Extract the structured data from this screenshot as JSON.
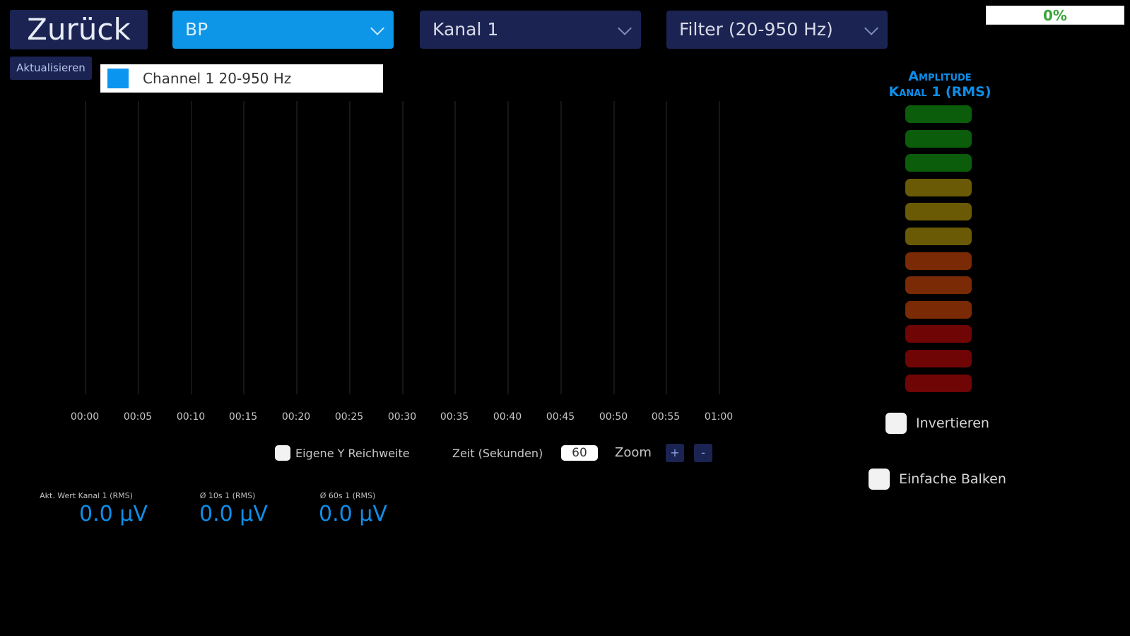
{
  "header": {
    "back_label": "Zurück",
    "refresh_label": "Aktualisieren",
    "mode_select": "BP",
    "channel_select": "Kanal 1",
    "filter_select": "Filter (20-950 Hz)",
    "progress": {
      "value": 0,
      "label": "0%"
    }
  },
  "chart_data": {
    "type": "line",
    "legend": [
      "Channel 1 20-950 Hz"
    ],
    "x_ticks": [
      "00:00",
      "00:05",
      "00:10",
      "00:15",
      "00:20",
      "00:25",
      "00:30",
      "00:35",
      "00:40",
      "00:45",
      "00:50",
      "00:55",
      "01:00"
    ],
    "series": [
      {
        "name": "Channel 1 20-950 Hz",
        "color": "#0a96f0",
        "values": []
      }
    ],
    "grid": "vertical"
  },
  "amplitude": {
    "title_line1": "Amplitude",
    "title_line2": "Kanal 1 (RMS)",
    "bar_colors": [
      "#0b5c0b",
      "#0b5c0b",
      "#0b5c0b",
      "#6b5a05",
      "#6b5a05",
      "#6b5a05",
      "#7a2a05",
      "#7a2a05",
      "#7a2a05",
      "#700505",
      "#700505",
      "#700505"
    ],
    "lit_bars": 0
  },
  "controls": {
    "own_y_range_label": "Eigene Y Reichweite",
    "own_y_range_checked": false,
    "time_label": "Zeit (Sekunden)",
    "time_value": "60",
    "zoom_label": "Zoom",
    "zoom_in": "+",
    "zoom_out": "-",
    "invert_label": "Invertieren",
    "invert_checked": false,
    "simple_bars_label": "Einfache Balken",
    "simple_bars_checked": false
  },
  "stats": [
    {
      "label": "Akt. Wert Kanal 1 (RMS)",
      "value": "0.0 μV"
    },
    {
      "label": "Ø 10s 1 (RMS)",
      "value": "0.0 μV"
    },
    {
      "label": "Ø 60s 1 (RMS)",
      "value": "0.0 μV"
    }
  ]
}
